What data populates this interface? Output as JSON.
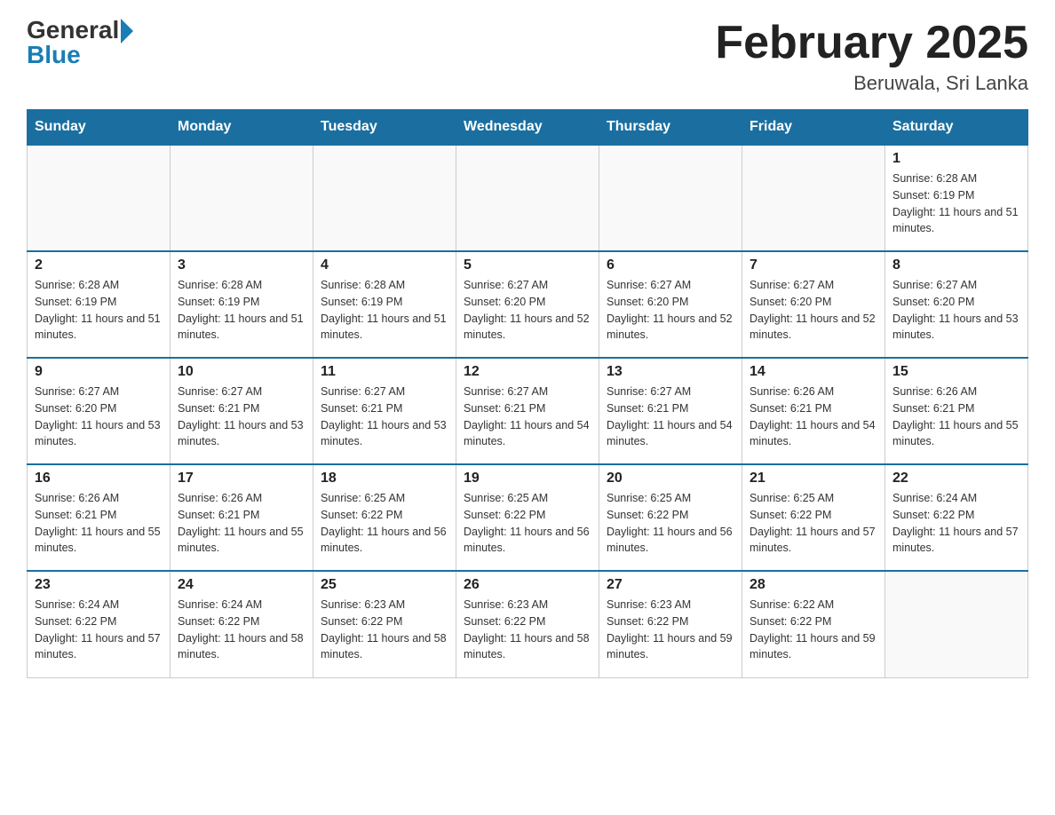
{
  "header": {
    "logo_general": "General",
    "logo_blue": "Blue",
    "month_title": "February 2025",
    "location": "Beruwala, Sri Lanka"
  },
  "days_of_week": [
    "Sunday",
    "Monday",
    "Tuesday",
    "Wednesday",
    "Thursday",
    "Friday",
    "Saturday"
  ],
  "weeks": [
    [
      {
        "day": "",
        "info": ""
      },
      {
        "day": "",
        "info": ""
      },
      {
        "day": "",
        "info": ""
      },
      {
        "day": "",
        "info": ""
      },
      {
        "day": "",
        "info": ""
      },
      {
        "day": "",
        "info": ""
      },
      {
        "day": "1",
        "info": "Sunrise: 6:28 AM\nSunset: 6:19 PM\nDaylight: 11 hours and 51 minutes."
      }
    ],
    [
      {
        "day": "2",
        "info": "Sunrise: 6:28 AM\nSunset: 6:19 PM\nDaylight: 11 hours and 51 minutes."
      },
      {
        "day": "3",
        "info": "Sunrise: 6:28 AM\nSunset: 6:19 PM\nDaylight: 11 hours and 51 minutes."
      },
      {
        "day": "4",
        "info": "Sunrise: 6:28 AM\nSunset: 6:19 PM\nDaylight: 11 hours and 51 minutes."
      },
      {
        "day": "5",
        "info": "Sunrise: 6:27 AM\nSunset: 6:20 PM\nDaylight: 11 hours and 52 minutes."
      },
      {
        "day": "6",
        "info": "Sunrise: 6:27 AM\nSunset: 6:20 PM\nDaylight: 11 hours and 52 minutes."
      },
      {
        "day": "7",
        "info": "Sunrise: 6:27 AM\nSunset: 6:20 PM\nDaylight: 11 hours and 52 minutes."
      },
      {
        "day": "8",
        "info": "Sunrise: 6:27 AM\nSunset: 6:20 PM\nDaylight: 11 hours and 53 minutes."
      }
    ],
    [
      {
        "day": "9",
        "info": "Sunrise: 6:27 AM\nSunset: 6:20 PM\nDaylight: 11 hours and 53 minutes."
      },
      {
        "day": "10",
        "info": "Sunrise: 6:27 AM\nSunset: 6:21 PM\nDaylight: 11 hours and 53 minutes."
      },
      {
        "day": "11",
        "info": "Sunrise: 6:27 AM\nSunset: 6:21 PM\nDaylight: 11 hours and 53 minutes."
      },
      {
        "day": "12",
        "info": "Sunrise: 6:27 AM\nSunset: 6:21 PM\nDaylight: 11 hours and 54 minutes."
      },
      {
        "day": "13",
        "info": "Sunrise: 6:27 AM\nSunset: 6:21 PM\nDaylight: 11 hours and 54 minutes."
      },
      {
        "day": "14",
        "info": "Sunrise: 6:26 AM\nSunset: 6:21 PM\nDaylight: 11 hours and 54 minutes."
      },
      {
        "day": "15",
        "info": "Sunrise: 6:26 AM\nSunset: 6:21 PM\nDaylight: 11 hours and 55 minutes."
      }
    ],
    [
      {
        "day": "16",
        "info": "Sunrise: 6:26 AM\nSunset: 6:21 PM\nDaylight: 11 hours and 55 minutes."
      },
      {
        "day": "17",
        "info": "Sunrise: 6:26 AM\nSunset: 6:21 PM\nDaylight: 11 hours and 55 minutes."
      },
      {
        "day": "18",
        "info": "Sunrise: 6:25 AM\nSunset: 6:22 PM\nDaylight: 11 hours and 56 minutes."
      },
      {
        "day": "19",
        "info": "Sunrise: 6:25 AM\nSunset: 6:22 PM\nDaylight: 11 hours and 56 minutes."
      },
      {
        "day": "20",
        "info": "Sunrise: 6:25 AM\nSunset: 6:22 PM\nDaylight: 11 hours and 56 minutes."
      },
      {
        "day": "21",
        "info": "Sunrise: 6:25 AM\nSunset: 6:22 PM\nDaylight: 11 hours and 57 minutes."
      },
      {
        "day": "22",
        "info": "Sunrise: 6:24 AM\nSunset: 6:22 PM\nDaylight: 11 hours and 57 minutes."
      }
    ],
    [
      {
        "day": "23",
        "info": "Sunrise: 6:24 AM\nSunset: 6:22 PM\nDaylight: 11 hours and 57 minutes."
      },
      {
        "day": "24",
        "info": "Sunrise: 6:24 AM\nSunset: 6:22 PM\nDaylight: 11 hours and 58 minutes."
      },
      {
        "day": "25",
        "info": "Sunrise: 6:23 AM\nSunset: 6:22 PM\nDaylight: 11 hours and 58 minutes."
      },
      {
        "day": "26",
        "info": "Sunrise: 6:23 AM\nSunset: 6:22 PM\nDaylight: 11 hours and 58 minutes."
      },
      {
        "day": "27",
        "info": "Sunrise: 6:23 AM\nSunset: 6:22 PM\nDaylight: 11 hours and 59 minutes."
      },
      {
        "day": "28",
        "info": "Sunrise: 6:22 AM\nSunset: 6:22 PM\nDaylight: 11 hours and 59 minutes."
      },
      {
        "day": "",
        "info": ""
      }
    ]
  ]
}
